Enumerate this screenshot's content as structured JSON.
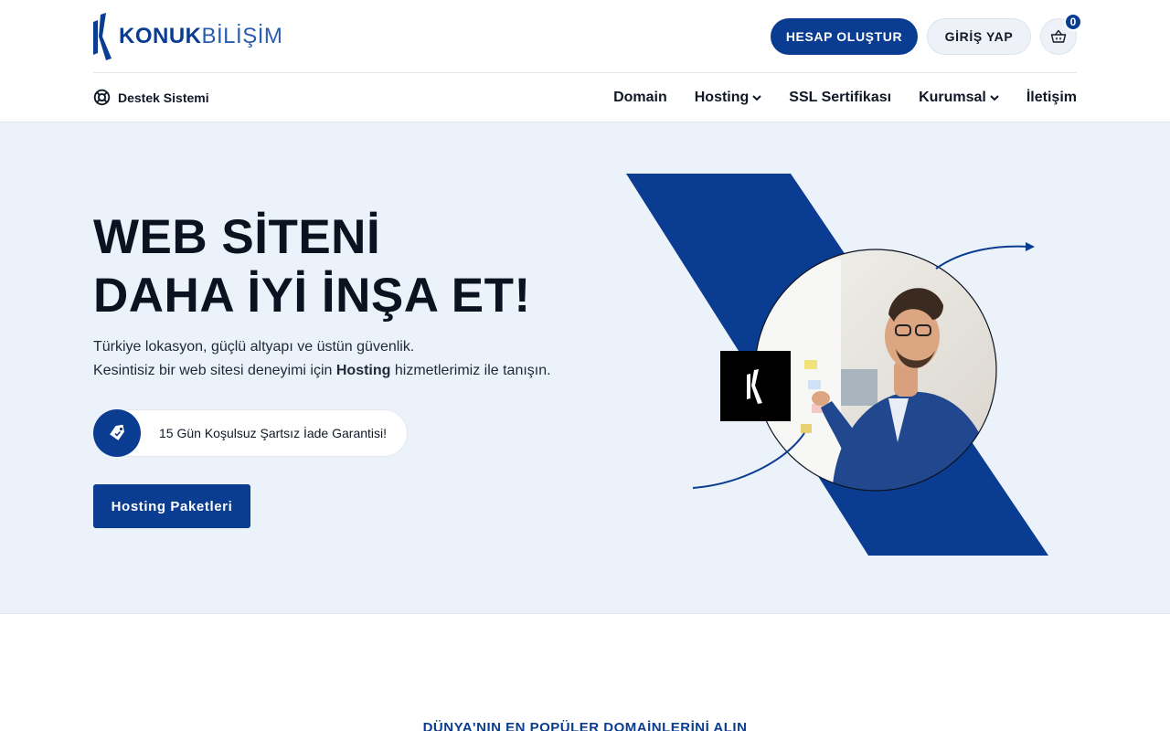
{
  "brand": {
    "name_bold": "KONUK",
    "name_light": "BİLİŞİM",
    "primary_color": "#0a3d91",
    "hero_background": "#ecf2f9"
  },
  "header": {
    "create_account_label": "HESAP OLUŞTUR",
    "login_label": "GİRİŞ YAP",
    "cart_icon": "basket-icon",
    "cart_count": "0",
    "support_label": "Destek Sistemi",
    "support_icon": "lifebuoy-icon"
  },
  "nav": {
    "items": [
      {
        "label": "Domain"
      },
      {
        "label": "Hosting"
      },
      {
        "label": "SSL Sertifikası"
      },
      {
        "label": "Kurumsal"
      },
      {
        "label": "İletişim"
      }
    ]
  },
  "hero": {
    "title_line1": "WEB SİTENİ",
    "title_line2": "DAHA İYİ İNŞA ET!",
    "desc_line1": "Türkiye lokasyon, güçlü altyapı ve üstün güvenlik.",
    "desc_line2_prefix": "Kesintisiz bir web sitesi deneyimi için ",
    "desc_line2_bold": "Hosting",
    "desc_line2_suffix": " hizmetlerimiz ile tanışın.",
    "guarantee_text": "15 Gün Koşulsuz Şartsız İade Garantisi!",
    "guarantee_icon": "tag-icon",
    "cta_label": "Hosting Paketleri"
  },
  "next_section": {
    "title": "DÜNYA'NIN EN POPÜLER DOMAİNLERİNİ ALIN"
  }
}
